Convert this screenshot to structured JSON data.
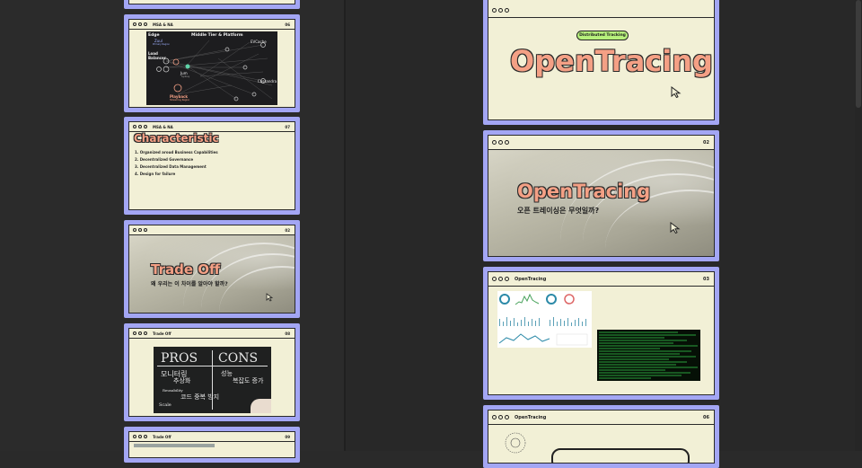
{
  "left_pane": {
    "slides": [
      {
        "id": "arch",
        "section": "MSA & NA",
        "page": "06",
        "labels": {
          "edge": "Edge",
          "middle": "Middle Tier & Platform",
          "zuul": "Zuul",
          "zuul_sub": "Primary Region",
          "evcache": "EVCache",
          "lb": "Load Balancer",
          "jum": "Jum",
          "jum_sub": "Sydney",
          "cassandra": "Cassandra",
          "playback": "Playback",
          "playback_sub": "Streaming Region"
        }
      },
      {
        "id": "char",
        "section": "MSA & NA",
        "page": "07",
        "title": "Characteristic",
        "items": [
          "1. Organized aroud Business Capabilities",
          "2. Decentralized Governance",
          "3. Decentralized Data Management",
          "4. Design for failure"
        ]
      },
      {
        "id": "tradeoff",
        "page": "02",
        "title": "Trade Off",
        "subtitle": "왜 우리는 이 차이를 알아야 할까?"
      },
      {
        "id": "proscons",
        "section": "Trade Off",
        "page": "08",
        "board": {
          "pros": "PROS",
          "cons": "CONS",
          "w1": "모니터링",
          "w2": "추상화",
          "w3": "성능",
          "w4": "복잡도 증가",
          "w5": "Reusability",
          "w6": "코드 중복 방지",
          "w7": "Scale"
        }
      },
      {
        "id": "trade2",
        "section": "Trade Off",
        "page": "09"
      }
    ]
  },
  "right_pane": {
    "slides": [
      {
        "id": "ot1",
        "badge": "Distributed Tracking",
        "title": "OpenTracing"
      },
      {
        "id": "ot2",
        "page": "02",
        "title": "OpenTracing",
        "subtitle": "오픈 트레이싱은 무엇일까?"
      },
      {
        "id": "ot3",
        "section": "OpenTracing",
        "page": "03"
      },
      {
        "id": "ot4",
        "section": "OpenTracing",
        "page": "06"
      }
    ]
  },
  "colors": {
    "frame": "#a3a6f4",
    "paper": "#f2f0d6",
    "accent": "#f4a085",
    "pill": "#b7f07c"
  },
  "icons": [
    "cursor-arrow-icon",
    "window-dots-icon"
  ]
}
